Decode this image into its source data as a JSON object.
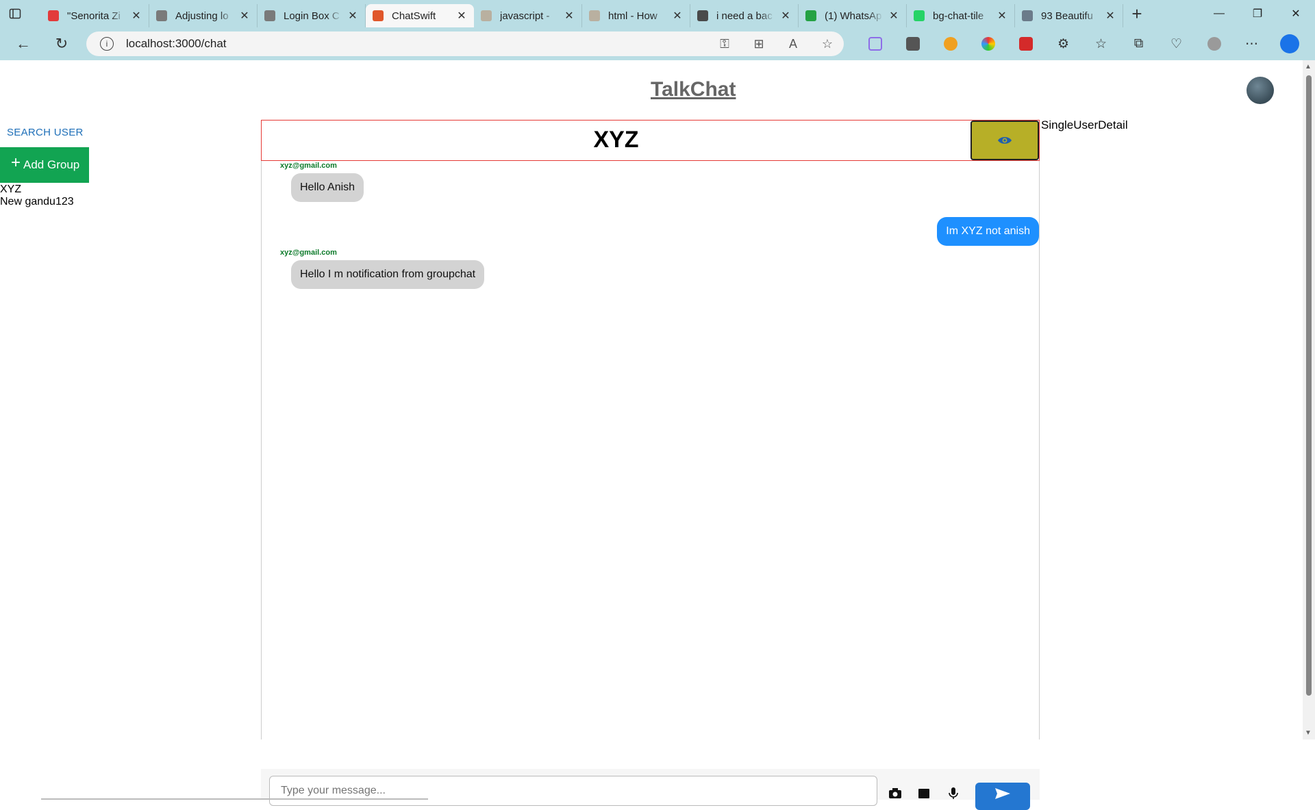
{
  "browser": {
    "tabs": [
      {
        "title": "\"Senorita Zi",
        "color": "#e23b3b"
      },
      {
        "title": "Adjusting lo",
        "color": "#7a7a7a"
      },
      {
        "title": "Login Box C",
        "color": "#7a7a7a"
      },
      {
        "title": "ChatSwift",
        "color": "#e0572b",
        "active": true
      },
      {
        "title": "javascript - ",
        "color": "#b9b0a0"
      },
      {
        "title": "html - How",
        "color": "#b9b0a0"
      },
      {
        "title": "i need a bac",
        "color": "#4a4a4a"
      },
      {
        "title": "(1) WhatsAp",
        "color": "#25a244"
      },
      {
        "title": "bg-chat-tile",
        "color": "#25d366"
      },
      {
        "title": "93 Beautifu",
        "color": "#6b7b8a"
      }
    ],
    "url": "localhost:3000/chat"
  },
  "app": {
    "title": "TalkChat",
    "search_user": "SEARCH USER",
    "add_group": "Add Group",
    "chats": [
      "XYZ",
      "New gandu123"
    ],
    "detail_label": "SingleUserDetail"
  },
  "chat": {
    "header_name": "XYZ",
    "messages": [
      {
        "sender": "xyz@gmail.com",
        "text": "Hello Anish",
        "direction": "in"
      },
      {
        "sender": "",
        "text": "Im XYZ not anish",
        "direction": "out"
      },
      {
        "sender": "xyz@gmail.com",
        "text": "Hello I m notification from groupchat",
        "direction": "in"
      }
    ],
    "input_placeholder": "Type your message..."
  }
}
